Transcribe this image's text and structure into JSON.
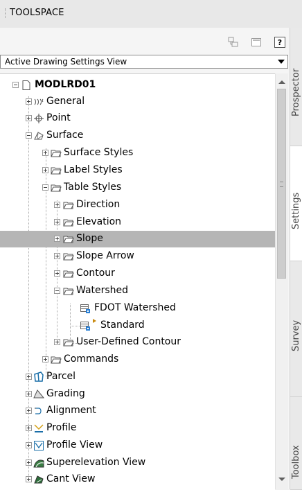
{
  "window": {
    "title": "TOOLSPACE"
  },
  "toolbar": {
    "help_label": "?"
  },
  "view_select": {
    "value": "Active Drawing Settings View"
  },
  "tree": {
    "root": "MODLRD01",
    "items": {
      "general": "General",
      "point": "Point",
      "surface": "Surface",
      "surface_styles": "Surface Styles",
      "label_styles": "Label Styles",
      "table_styles": "Table Styles",
      "direction": "Direction",
      "elevation": "Elevation",
      "slope": "Slope",
      "slope_arrow": "Slope Arrow",
      "contour": "Contour",
      "watershed": "Watershed",
      "fdot_watershed": "FDOT Watershed",
      "standard": "Standard",
      "user_defined_contour": "User-Defined Contour",
      "commands": "Commands",
      "parcel": "Parcel",
      "grading": "Grading",
      "alignment": "Alignment",
      "profile": "Profile",
      "profile_view": "Profile View",
      "superelevation_view": "Superelevation View",
      "cant_view": "Cant View"
    },
    "selected": "Slope"
  },
  "side_tabs": {
    "prospector": "Prospector",
    "settings": "Settings",
    "survey": "Survey",
    "toolbox": "Toolbox"
  },
  "colors": {
    "selection": "#b5b5b5",
    "folder_outline": "#555555",
    "parcel_icon": "#1a6ea8",
    "profile_icon": "#d4a017"
  }
}
